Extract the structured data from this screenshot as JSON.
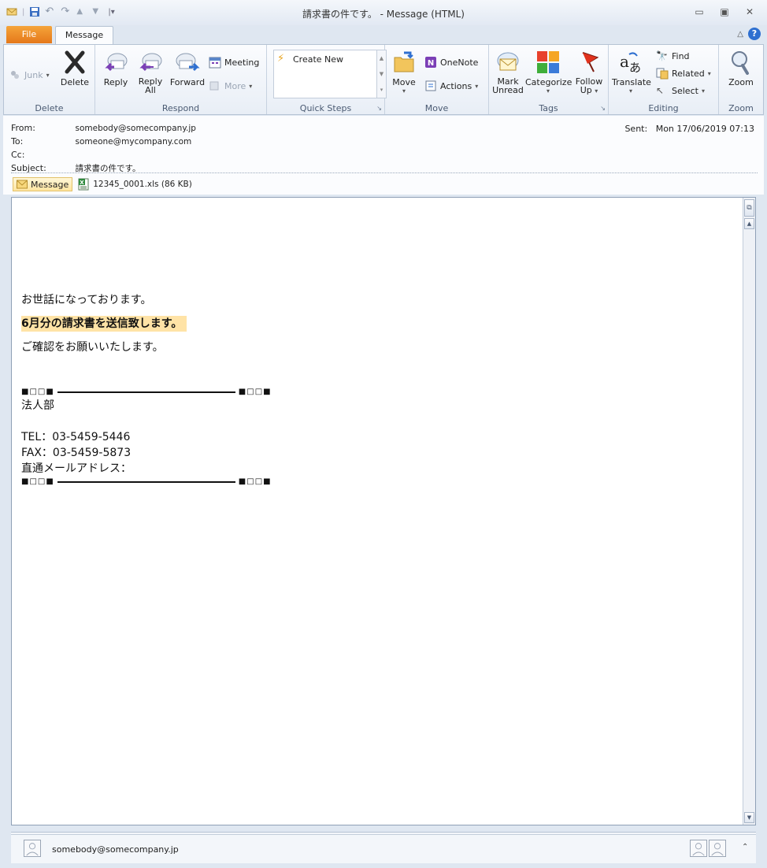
{
  "window": {
    "title": "請求書の件です。 - Message (HTML)"
  },
  "tabs": {
    "file": "File",
    "message": "Message"
  },
  "ribbon": {
    "delete_group": {
      "label": "Delete",
      "junk": "Junk",
      "delete": "Delete"
    },
    "respond_group": {
      "label": "Respond",
      "reply": "Reply",
      "reply_all_1": "Reply",
      "reply_all_2": "All",
      "forward": "Forward",
      "meeting": "Meeting",
      "more": "More"
    },
    "quick_steps": {
      "label": "Quick Steps",
      "create_new": "Create New"
    },
    "move_group": {
      "label": "Move",
      "move": "Move",
      "onenote": "OneNote",
      "actions": "Actions"
    },
    "tags_group": {
      "label": "Tags",
      "mark_unread_1": "Mark",
      "mark_unread_2": "Unread",
      "categorize": "Categorize",
      "follow_up_1": "Follow",
      "follow_up_2": "Up"
    },
    "editing_group": {
      "label": "Editing",
      "translate": "Translate",
      "find": "Find",
      "related": "Related",
      "select": "Select"
    },
    "zoom_group": {
      "label": "Zoom",
      "zoom": "Zoom"
    }
  },
  "header": {
    "from_label": "From:",
    "from_value": "somebody@somecompany.jp",
    "to_label": "To:",
    "to_value": "someone@mycompany.com",
    "cc_label": "Cc:",
    "subject_label": "Subject:",
    "subject_value": "請求書の件です。",
    "sent_label": "Sent:",
    "sent_value": "Mon 17/06/2019 07:13"
  },
  "attachments": {
    "message_tab": "Message",
    "file": "12345_0001.xls (86 KB)"
  },
  "body": {
    "greeting": "お世話になっております。",
    "highlight": "6月分の請求書を送信致します。",
    "confirm": "ご確認をお願いいたします。",
    "sig_left": "■□□■",
    "sig_right": "■□□■",
    "dept": "法人部",
    "tel": "TEL：03-5459-5446",
    "fax": "FAX：03-5459-5873",
    "mail": "直通メールアドレス："
  },
  "people_pane": {
    "name": "somebody@somecompany.jp"
  }
}
